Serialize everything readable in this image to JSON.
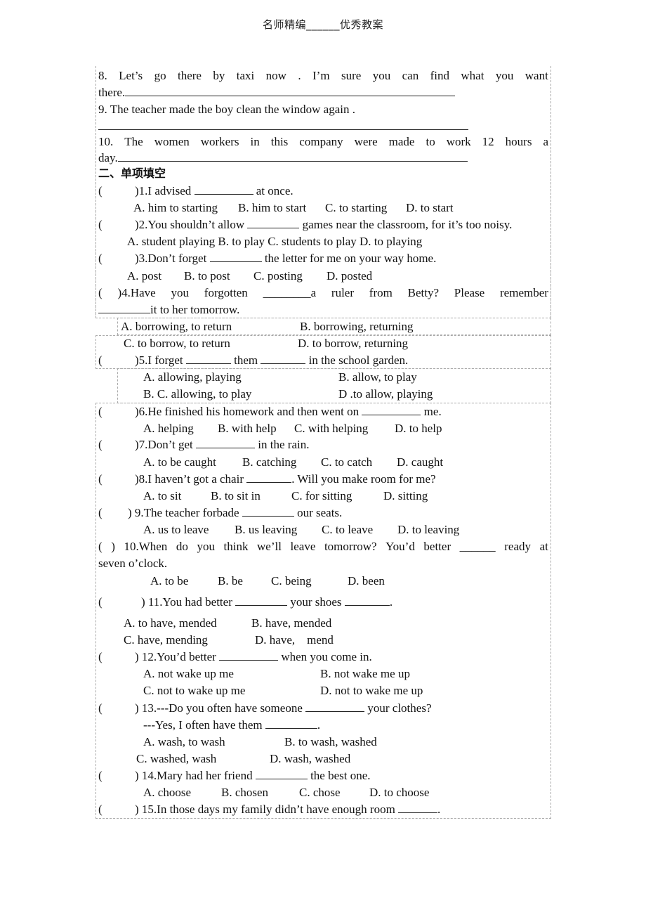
{
  "header": {
    "title": "名师精编______优秀教案"
  },
  "part1": {
    "items": [
      {
        "line1": [
          "8.",
          "Let’s",
          "go",
          "there",
          "by",
          "taxi",
          "now",
          ".",
          "I’m",
          "sure",
          "you",
          "can",
          "find",
          "what",
          "you",
          "want"
        ],
        "line2": "there."
      },
      {
        "line1_text": "9. The teacher made the boy clean the window again ."
      },
      {
        "line1": [
          "10.",
          "The",
          "women",
          "workers",
          "in",
          "this",
          "company",
          "were",
          "made",
          "to",
          "work",
          "12",
          "hours",
          "a"
        ],
        "line2": "day."
      }
    ]
  },
  "section2": {
    "title": "二、单项填空"
  },
  "questions": [
    {
      "num": ")1.I advised",
      "after": "at once.",
      "options": [
        "A. him to starting",
        "B. him to start",
        "C. to starting",
        "D. to start"
      ]
    },
    {
      "num": ")2.You shouldn’t allow",
      "after": "games near the classroom, for it’s too noisy.",
      "options_line": "A. student playing B. to play C. students to play D. to playing"
    },
    {
      "num": ")3.Don’t forget",
      "after": "the letter for me on your way home.",
      "options": [
        "A. post",
        "B. to post",
        "C. posting",
        "D. posted"
      ]
    },
    {
      "line1": [
        "(",
        ")4.Have",
        "you",
        "forgotten",
        "________a",
        "ruler",
        "from",
        "Betty?",
        "Please",
        "remember"
      ],
      "line2": "it to her tomorrow.",
      "options": [
        "A. borrowing, to return",
        "B. borrowing, returning",
        "C. to borrow, to return",
        "D. to borrow, returning"
      ]
    },
    {
      "num": ")5.I forget",
      "mid": "them",
      "after": "in the school garden.",
      "options": [
        "A. allowing, playing",
        "B. allow, to play",
        "B. C. allowing, to play",
        "D .to allow, playing"
      ]
    },
    {
      "num": ")6.He finished his homework and then went on",
      "after": "me.",
      "options": [
        "A. helping",
        "B. with help",
        "C. with helping",
        "D. to help"
      ]
    },
    {
      "num": ")7.Don’t get",
      "after": "in the rain.",
      "options": [
        "A. to be caught",
        "B. catching",
        "C. to catch",
        "D. caught"
      ]
    },
    {
      "num": ")8.I haven’t got a chair",
      "after": ". Will you make room for me?",
      "options": [
        "A. to sit",
        "B. to sit in",
        "C. for sitting",
        "D. sitting"
      ]
    },
    {
      "num": ") 9.The teacher forbade",
      "after": "our seats.",
      "options": [
        "A. us to leave",
        "B. us leaving",
        "C. to leave",
        "D. to leaving"
      ]
    },
    {
      "line1": [
        "(",
        ")",
        "10.When",
        "do",
        "you",
        "think",
        "we’ll",
        "leave",
        "tomorrow?",
        "You’d",
        "better",
        "______",
        "ready",
        "at"
      ],
      "line2": "seven o’clock.",
      "options": [
        "A. to be",
        "B. be",
        "C. being",
        "D. been"
      ]
    },
    {
      "num": ") 11.You had better",
      "mid": "your shoes",
      "after": ".",
      "options": [
        "A. to have, mended",
        "B. have, mended",
        "C. have, mending",
        "D. have,    mend"
      ]
    },
    {
      "num": ") 12.You’d better",
      "after": "when you come in.",
      "options": [
        "A. not wake up me",
        "B. not wake me up",
        "C. not to wake up me",
        "D. not to wake me up"
      ]
    },
    {
      "num": ") 13.---Do you often have someone",
      "after": "your clothes?",
      "line2a": "---Yes, I often have them",
      "line2b": ".",
      "options": [
        "A. wash, to wash",
        "B. to wash, washed",
        "C. washed, wash",
        "D. wash, washed"
      ]
    },
    {
      "num": ") 14.Mary had her friend",
      "after": "the best one.",
      "options": [
        "A. choose",
        "B. chosen",
        "C. chose",
        "D. to choose"
      ]
    },
    {
      "num": ") 15.In those days my family didn’t have enough room",
      "after": "."
    }
  ],
  "paren_open": "("
}
